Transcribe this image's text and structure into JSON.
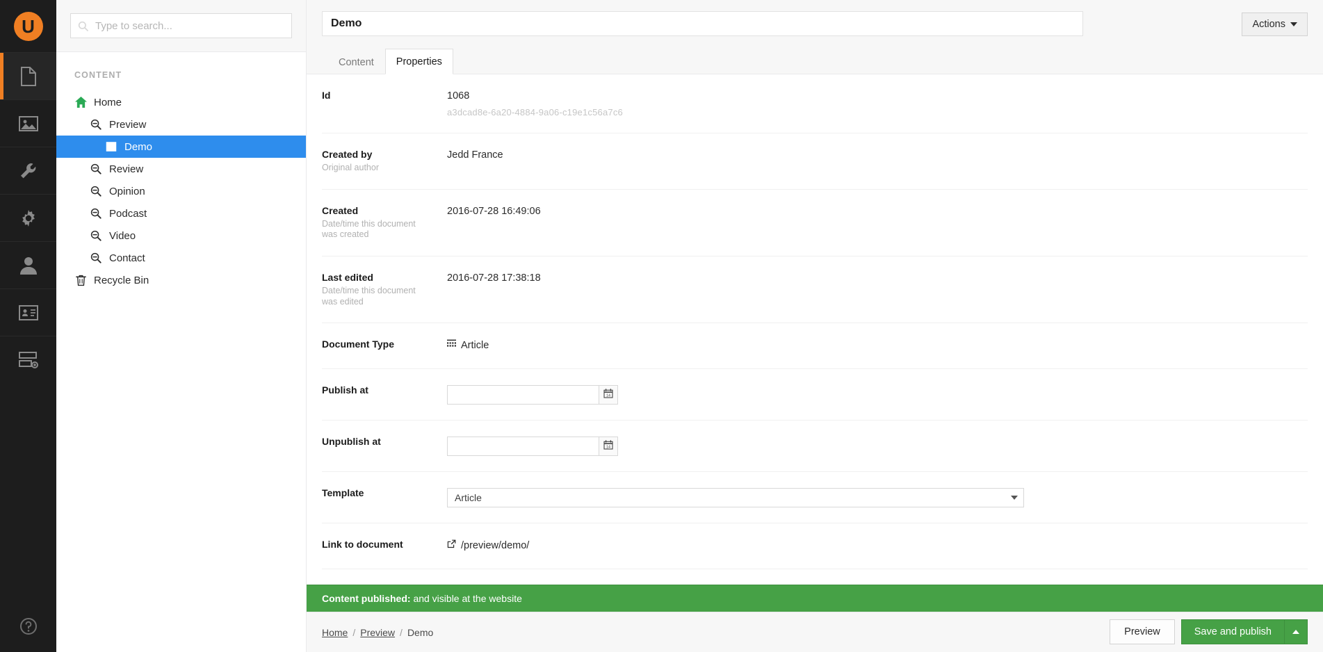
{
  "rail": {
    "logo_glyph": "U",
    "logo_color": "#f07f23",
    "items": [
      {
        "name": "content",
        "icon": "document-icon",
        "active": true
      },
      {
        "name": "media",
        "icon": "image-icon",
        "active": false
      },
      {
        "name": "settings",
        "icon": "wrench-icon",
        "active": false
      },
      {
        "name": "developer",
        "icon": "gear-icon",
        "active": false
      },
      {
        "name": "users",
        "icon": "user-icon",
        "active": false
      },
      {
        "name": "members",
        "icon": "id-card-icon",
        "active": false
      },
      {
        "name": "forms",
        "icon": "forms-icon",
        "active": false
      }
    ],
    "help_icon": "help-circle-icon"
  },
  "search": {
    "placeholder": "Type to search...",
    "value": "",
    "icon": "search-icon"
  },
  "tree": {
    "heading": "CONTENT",
    "nodes": [
      {
        "label": "Home",
        "icon": "home-icon",
        "depth": 0,
        "selected": false
      },
      {
        "label": "Preview",
        "icon": "zoom-out-icon",
        "depth": 1,
        "selected": false
      },
      {
        "label": "Demo",
        "icon": "article-icon",
        "depth": 2,
        "selected": true
      },
      {
        "label": "Review",
        "icon": "zoom-out-icon",
        "depth": 1,
        "selected": false
      },
      {
        "label": "Opinion",
        "icon": "zoom-out-icon",
        "depth": 1,
        "selected": false
      },
      {
        "label": "Podcast",
        "icon": "zoom-out-icon",
        "depth": 1,
        "selected": false
      },
      {
        "label": "Video",
        "icon": "zoom-out-icon",
        "depth": 1,
        "selected": false
      },
      {
        "label": "Contact",
        "icon": "zoom-out-icon",
        "depth": 1,
        "selected": false
      },
      {
        "label": "Recycle Bin",
        "icon": "trash-icon",
        "depth": 0,
        "selected": false
      }
    ]
  },
  "editor": {
    "document_title": "Demo",
    "actions_label": "Actions",
    "tabs": [
      {
        "label": "Content",
        "active": false
      },
      {
        "label": "Properties",
        "active": true
      }
    ]
  },
  "properties": {
    "id": {
      "label": "Id",
      "description": "",
      "value": "1068",
      "guid": "a3dcad8e-6a20-4884-9a06-c19e1c56a7c6"
    },
    "created_by": {
      "label": "Created by",
      "description": "Original author",
      "value": "Jedd France"
    },
    "created": {
      "label": "Created",
      "description": "Date/time this document was created",
      "value": "2016-07-28 16:49:06"
    },
    "last_edited": {
      "label": "Last edited",
      "description": "Date/time this document was edited",
      "value": "2016-07-28 17:38:18"
    },
    "document_type": {
      "label": "Document Type",
      "description": "",
      "value": "Article",
      "icon": "grid-dots-icon"
    },
    "publish_at": {
      "label": "Publish at",
      "description": "",
      "value": "",
      "placeholder": "",
      "button_icon": "calendar-icon"
    },
    "unpublish_at": {
      "label": "Unpublish at",
      "description": "",
      "value": "",
      "placeholder": "",
      "button_icon": "calendar-icon"
    },
    "template": {
      "label": "Template",
      "description": "",
      "selected": "Article",
      "options": [
        "Article"
      ]
    },
    "link_to_document": {
      "label": "Link to document",
      "description": "",
      "value": "/preview/demo/",
      "icon": "external-link-icon"
    }
  },
  "notice": {
    "strong": "Content published:",
    "text": "and visible at the website",
    "color": "#46a146"
  },
  "breadcrumb": {
    "items": [
      "Home",
      "Preview",
      "Demo"
    ],
    "separator": "/"
  },
  "footer_actions": {
    "preview_label": "Preview",
    "publish_label": "Save and publish",
    "publish_color": "#46a146",
    "caret_icon": "caret-up-icon"
  }
}
